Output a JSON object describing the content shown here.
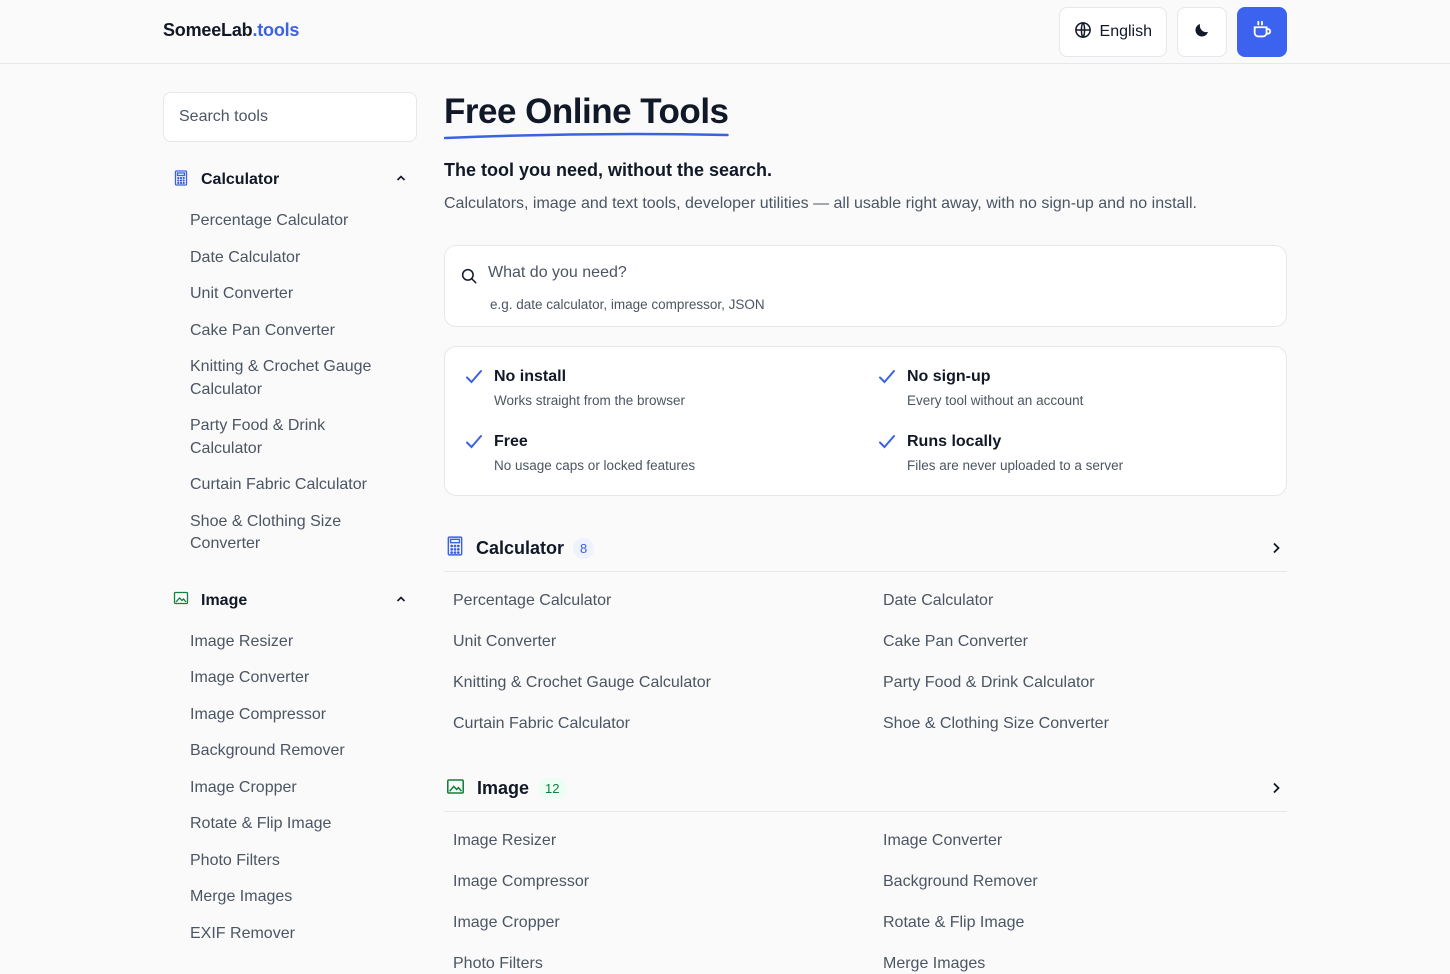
{
  "header": {
    "brand_main": "SomeeLab",
    "brand_accent": ".tools",
    "language_label": "English"
  },
  "sidebar": {
    "search_placeholder": "Search tools",
    "groups": [
      {
        "label": "Calculator",
        "items": [
          "Percentage Calculator",
          "Date Calculator",
          "Unit Converter",
          "Cake Pan Converter",
          "Knitting & Crochet Gauge Calculator",
          "Party Food & Drink Calculator",
          "Curtain Fabric Calculator",
          "Shoe & Clothing Size Converter"
        ]
      },
      {
        "label": "Image",
        "items": [
          "Image Resizer",
          "Image Converter",
          "Image Compressor",
          "Background Remover",
          "Image Cropper",
          "Rotate & Flip Image",
          "Photo Filters",
          "Merge Images",
          "EXIF Remover"
        ]
      }
    ]
  },
  "main": {
    "title": "Free Online Tools",
    "subtitle": "The tool you need, without the search.",
    "description": "Calculators, image and text tools, developer utilities — all usable right away, with no sign-up and no install.",
    "finder": {
      "placeholder": "What do you need?",
      "hint": "e.g. date calculator, image compressor, JSON"
    },
    "features": [
      {
        "title": "No install",
        "desc": "Works straight from the browser"
      },
      {
        "title": "No sign-up",
        "desc": "Every tool without an account"
      },
      {
        "title": "Free",
        "desc": "No usage caps or locked features"
      },
      {
        "title": "Runs locally",
        "desc": "Files are never uploaded to a server"
      }
    ],
    "sections": [
      {
        "title": "Calculator",
        "count": "8",
        "tools": [
          "Percentage Calculator",
          "Date Calculator",
          "Unit Converter",
          "Cake Pan Converter",
          "Knitting & Crochet Gauge Calculator",
          "Party Food & Drink Calculator",
          "Curtain Fabric Calculator",
          "Shoe & Clothing Size Converter"
        ]
      },
      {
        "title": "Image",
        "count": "12",
        "tools": [
          "Image Resizer",
          "Image Converter",
          "Image Compressor",
          "Background Remover",
          "Image Cropper",
          "Rotate & Flip Image",
          "Photo Filters",
          "Merge Images"
        ]
      }
    ]
  },
  "colors": {
    "accent": "#3b63f0",
    "image_accent": "#15803d",
    "text_muted": "#4b5563",
    "border": "#e5e7eb"
  },
  "icons": [
    "globe-icon",
    "moon-icon",
    "coffee-cup-icon",
    "calculator-icon",
    "image-icon",
    "chevron-up-icon",
    "chevron-right-icon",
    "search-icon",
    "check-icon"
  ]
}
